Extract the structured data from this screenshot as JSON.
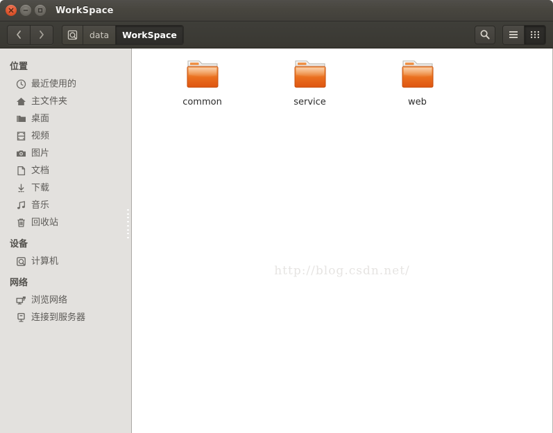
{
  "window": {
    "title": "WorkSpace",
    "controls": [
      {
        "name": "close",
        "label": "Close",
        "icon": "close-icon",
        "color": "#e0562e"
      },
      {
        "name": "minimize",
        "label": "Minimize",
        "icon": "minimize-icon",
        "color": "#6d6a63"
      },
      {
        "name": "maximize",
        "label": "Maximize",
        "icon": "maximize-icon",
        "color": "#6d6a63"
      }
    ]
  },
  "toolbar": {
    "back_label": "‹",
    "forward_label": "›",
    "back_icon": "chevron-left-icon",
    "forward_icon": "chevron-right-icon",
    "breadcrumb": [
      {
        "label": "",
        "icon": "disk-icon",
        "active": false
      },
      {
        "label": "data",
        "icon": "",
        "active": false
      },
      {
        "label": "WorkSpace",
        "icon": "",
        "active": true
      }
    ],
    "search_icon": "search-icon",
    "list_view_icon": "list-view-icon",
    "grid_view_icon": "grid-view-icon",
    "active_view": "grid"
  },
  "sidebar": {
    "sections": [
      {
        "title": "位置",
        "items": [
          {
            "label": "最近使用的",
            "icon": "clock-icon"
          },
          {
            "label": "主文件夹",
            "icon": "home-icon"
          },
          {
            "label": "桌面",
            "icon": "folder-icon"
          },
          {
            "label": "视频",
            "icon": "film-icon"
          },
          {
            "label": "图片",
            "icon": "camera-icon"
          },
          {
            "label": "文档",
            "icon": "document-icon"
          },
          {
            "label": "下载",
            "icon": "download-icon"
          },
          {
            "label": "音乐",
            "icon": "music-icon"
          },
          {
            "label": "回收站",
            "icon": "trash-icon"
          }
        ]
      },
      {
        "title": "设备",
        "items": [
          {
            "label": "计算机",
            "icon": "computer-icon"
          }
        ]
      },
      {
        "title": "网络",
        "items": [
          {
            "label": "浏览网络",
            "icon": "network-browse-icon"
          },
          {
            "label": "连接到服务器",
            "icon": "server-connect-icon"
          }
        ]
      }
    ]
  },
  "content": {
    "folders": [
      {
        "label": "common",
        "icon": "folder-icon"
      },
      {
        "label": "service",
        "icon": "folder-icon"
      },
      {
        "label": "web",
        "icon": "folder-icon"
      }
    ],
    "watermark": "http://blog.csdn.net/"
  },
  "colors": {
    "titlebar": "#48463f",
    "toolbar": "#3b3a34",
    "sidebar": "#e3e1de",
    "content": "#ffffff",
    "folder_orange": "#e8641a",
    "text_dark": "#5c5a57",
    "text_light": "#f2f1ef"
  }
}
